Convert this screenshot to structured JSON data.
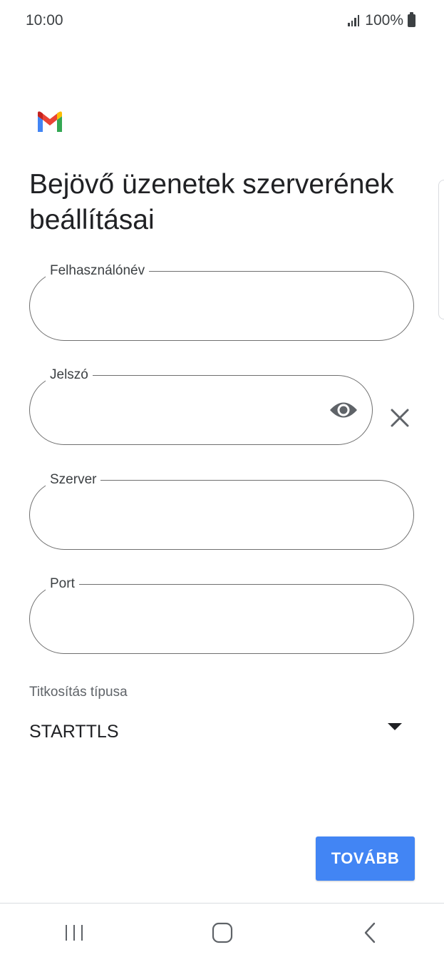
{
  "status_bar": {
    "time": "10:00",
    "battery": "100%"
  },
  "page": {
    "title": "Bejövő üzenetek szerverének beállításai"
  },
  "fields": [
    {
      "label": "Felhasználónév",
      "value": ""
    },
    {
      "label": "Jelszó",
      "value": ""
    },
    {
      "label": "Szerver",
      "value": ""
    },
    {
      "label": "Port",
      "value": ""
    }
  ],
  "encryption": {
    "label": "Titkosítás típusa",
    "value": "STARTTLS"
  },
  "actions": {
    "next_label": "TOVÁBB"
  },
  "colors": {
    "accent": "#4285f4",
    "outline": "#6f6f6f",
    "text": "#202124"
  },
  "icons": {
    "logo": "gmail-logo",
    "password_toggle": "eye-icon",
    "clear": "close-icon",
    "dropdown": "caret-down-icon",
    "nav": [
      "recent-apps-icon",
      "home-icon",
      "back-icon"
    ]
  }
}
